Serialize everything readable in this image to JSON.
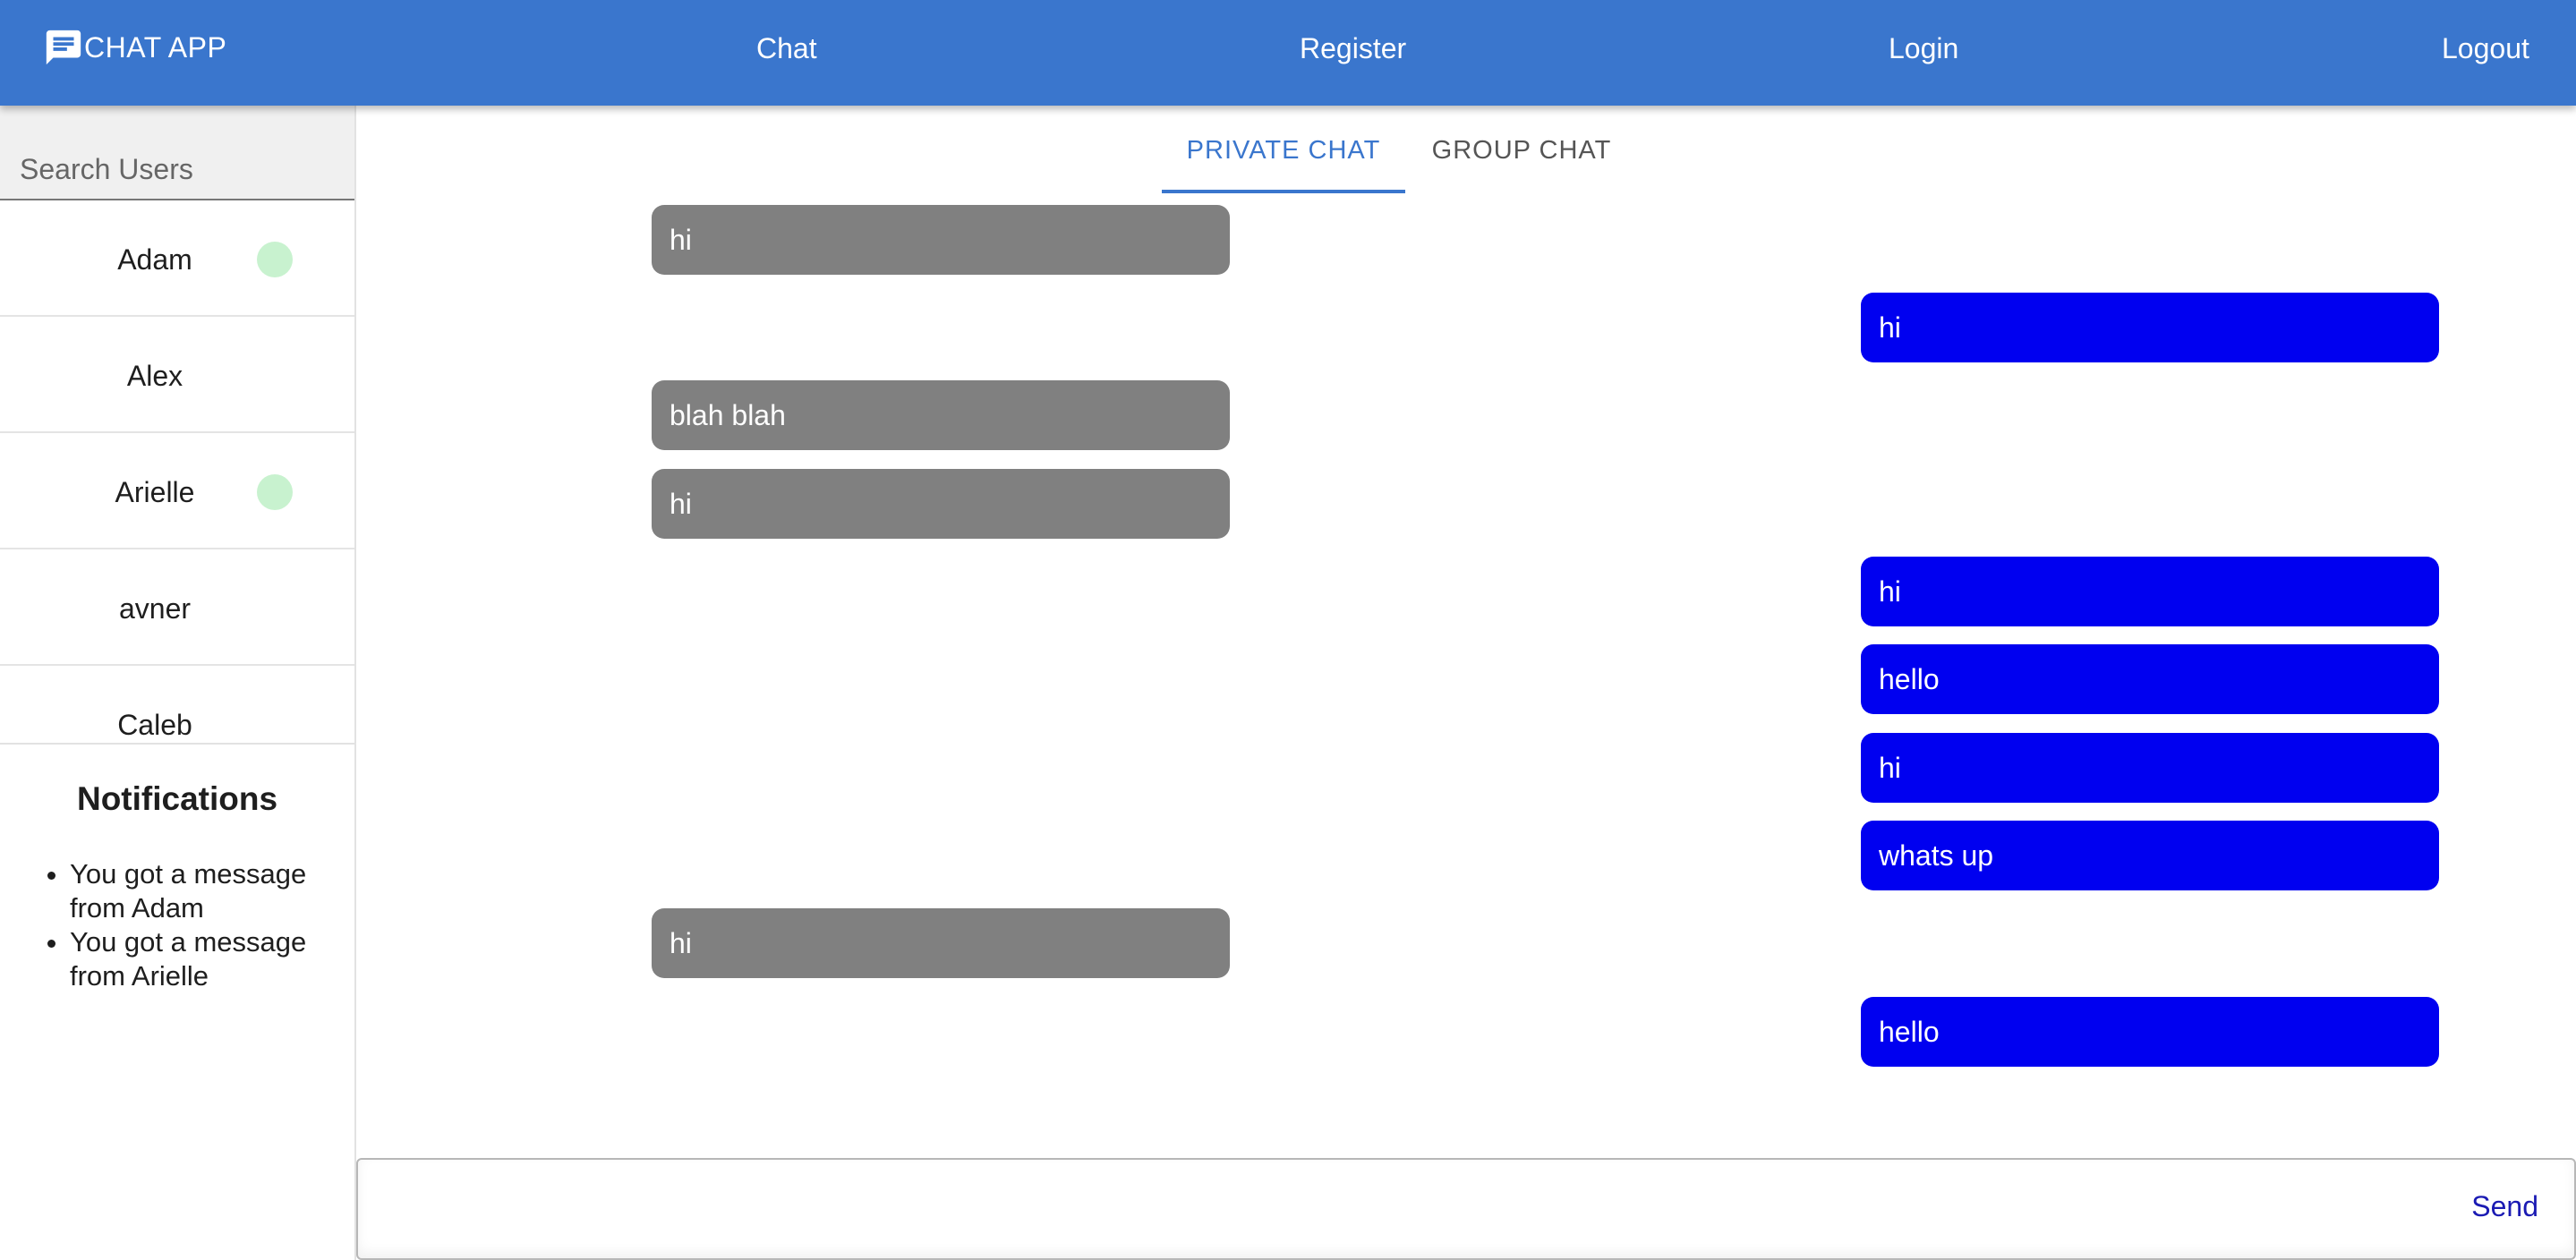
{
  "header": {
    "app_title": "CHAT APP",
    "brand_icon": "chat-bubble-icon",
    "nav": {
      "chat": "Chat",
      "register": "Register",
      "login": "Login",
      "logout": "Logout"
    },
    "bar_color": "#3a76cd"
  },
  "sidebar": {
    "search_placeholder": "Search Users",
    "users": [
      {
        "name": "Adam",
        "online": true
      },
      {
        "name": "Alex",
        "online": false
      },
      {
        "name": "Arielle",
        "online": true
      },
      {
        "name": "avner",
        "online": false
      },
      {
        "name": "Caleb",
        "online": false
      }
    ],
    "online_color": "#c8f2cf",
    "notifications": {
      "title": "Notifications",
      "items": [
        "You got a message from Adam",
        "You got a message from Arielle"
      ]
    }
  },
  "main": {
    "tabs": [
      {
        "label": "PRIVATE CHAT",
        "active": true
      },
      {
        "label": "GROUP CHAT",
        "active": false
      }
    ],
    "messages": [
      {
        "text": "hi",
        "direction": "received"
      },
      {
        "text": "hi",
        "direction": "sent"
      },
      {
        "text": "blah blah",
        "direction": "received"
      },
      {
        "text": "hi",
        "direction": "received"
      },
      {
        "text": "hi",
        "direction": "sent"
      },
      {
        "text": "hello",
        "direction": "sent"
      },
      {
        "text": "hi",
        "direction": "sent"
      },
      {
        "text": "whats up",
        "direction": "sent"
      },
      {
        "text": "hi",
        "direction": "received"
      },
      {
        "text": "hello",
        "direction": "sent"
      }
    ],
    "received_color": "#808080",
    "sent_color": "#0000f0",
    "composer": {
      "value": "",
      "send_label": "Send"
    }
  }
}
